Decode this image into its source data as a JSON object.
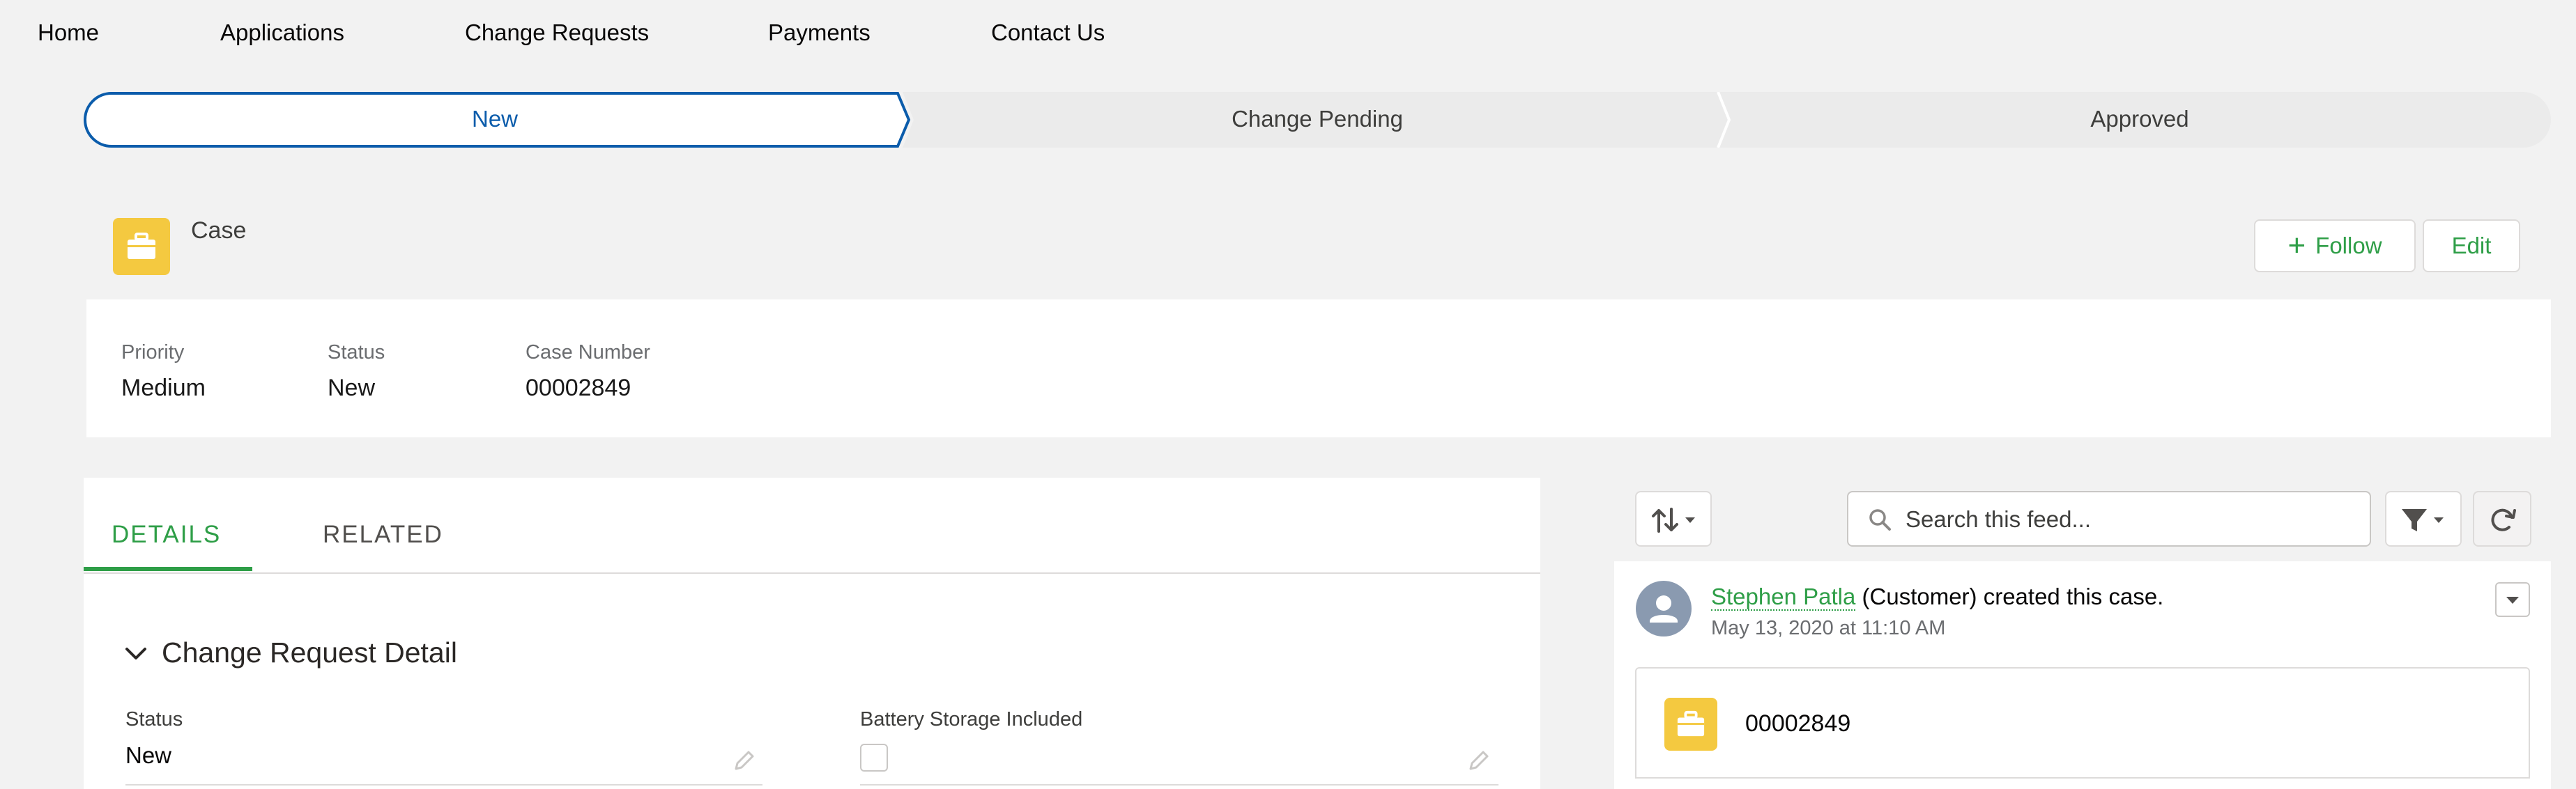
{
  "nav": {
    "items": [
      "Home",
      "Applications",
      "Change Requests",
      "Payments",
      "Contact Us"
    ]
  },
  "path": {
    "stages": [
      "New",
      "Change Pending",
      "Approved"
    ],
    "current_stage": "New"
  },
  "record": {
    "object_label": "Case",
    "follow_label": "Follow",
    "edit_label": "Edit"
  },
  "highlights": {
    "fields": [
      {
        "label": "Priority",
        "value": "Medium"
      },
      {
        "label": "Status",
        "value": "New"
      },
      {
        "label": "Case Number",
        "value": "00002849"
      }
    ]
  },
  "tabs": {
    "items": [
      "DETAILS",
      "RELATED"
    ],
    "active": "DETAILS"
  },
  "details": {
    "section_title": "Change Request Detail",
    "fields": [
      {
        "label": "Status",
        "value": "New"
      },
      {
        "label": "Battery Storage Included",
        "value": false
      }
    ]
  },
  "feed": {
    "search_placeholder": "Search this feed...",
    "item": {
      "author": "Stephen Patla",
      "rest": "(Customer) created this case.",
      "timestamp": "May 13, 2020 at 11:10 AM",
      "record_number": "00002849"
    }
  },
  "colors": {
    "brand_green": "#2e9e47",
    "path_active_blue": "#0b5cab",
    "case_icon_yellow": "#f4c940"
  }
}
